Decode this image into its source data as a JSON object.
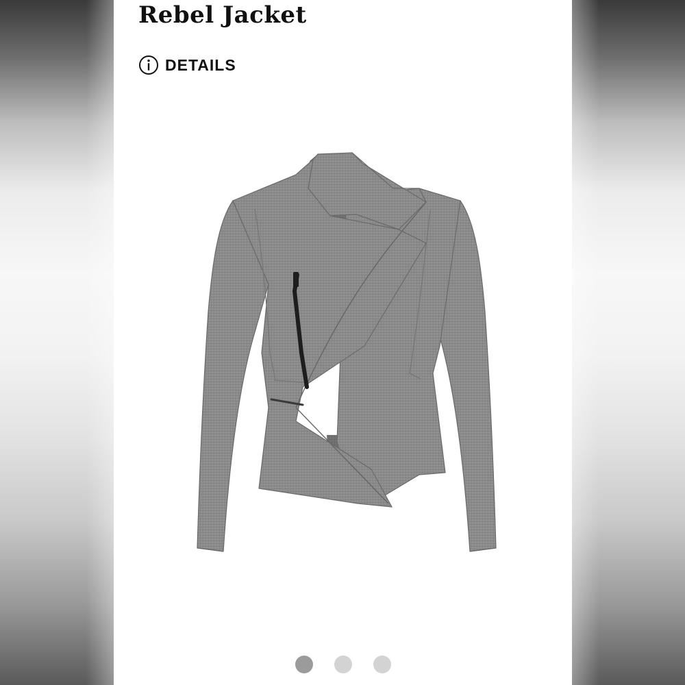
{
  "product": {
    "title": "Rebel Jacket",
    "details_label": "DETAILS",
    "image_alt": "grey herringbone asymmetric zip jacket"
  },
  "icons": {
    "details_icon": "info-circle-icon"
  },
  "carousel": {
    "total": 3,
    "active_index": 0,
    "dots": [
      {
        "color": "#9b9b9b"
      },
      {
        "color": "#d3d3d3"
      },
      {
        "color": "#d3d3d3"
      }
    ]
  },
  "colors": {
    "jacket_fabric": "#8a8a8a",
    "zipper": "#1e1e1e"
  }
}
